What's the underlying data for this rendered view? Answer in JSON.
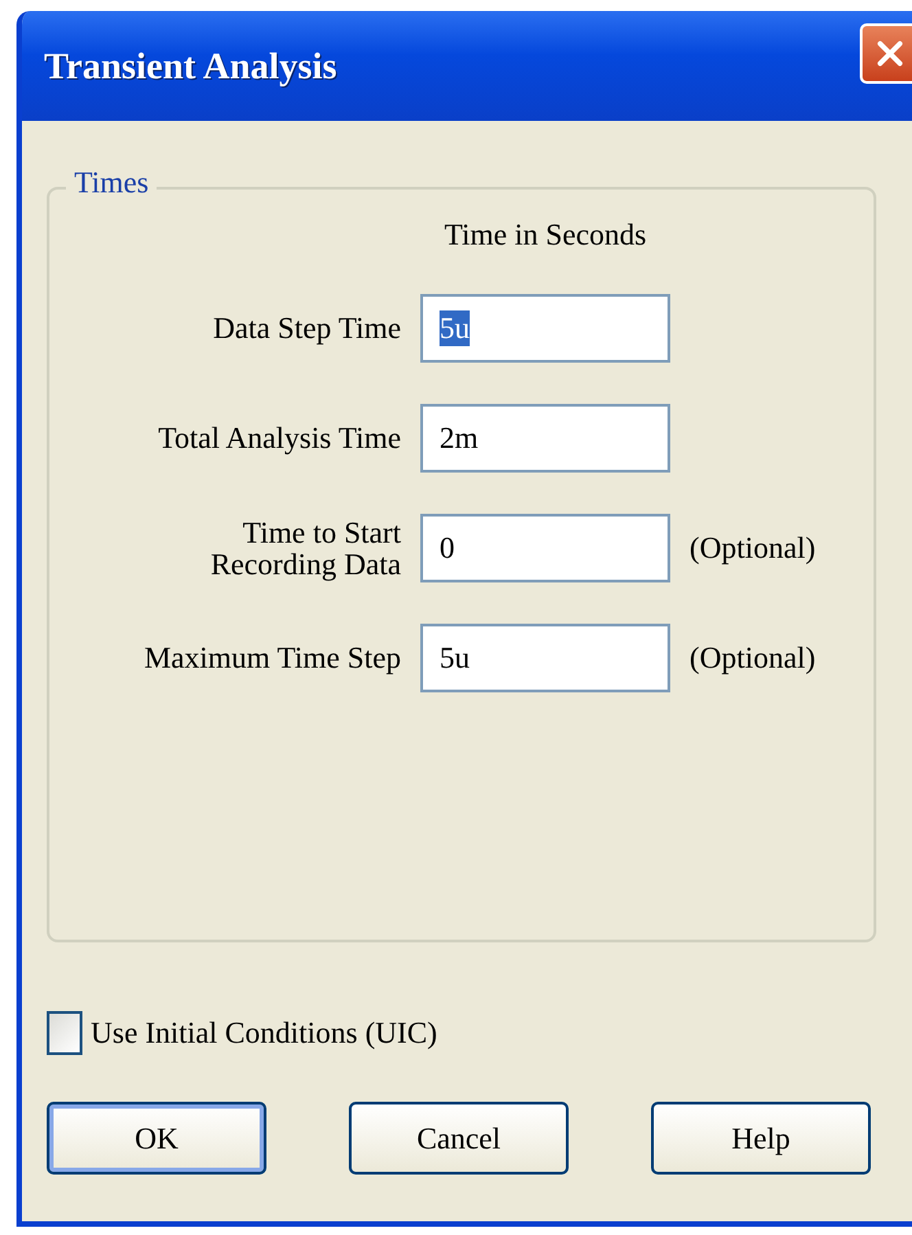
{
  "window": {
    "title": "Transient Analysis"
  },
  "group": {
    "title": "Times",
    "column_heading": "Time in Seconds",
    "fields": [
      {
        "label": "Data Step Time",
        "value": "5u",
        "text_selected": true
      },
      {
        "label": "Total Analysis Time",
        "value": "2m",
        "text_selected": false
      },
      {
        "label": "Time to Start\nRecording Data",
        "value": "0",
        "text_selected": false,
        "note": "(Optional)"
      },
      {
        "label": "Maximum Time Step",
        "value": "5u",
        "text_selected": false,
        "note": "(Optional)"
      }
    ]
  },
  "checkbox": {
    "label": "Use Initial Conditions (UIC)",
    "checked": false
  },
  "buttons": [
    {
      "label": "OK",
      "default": true
    },
    {
      "label": "Cancel",
      "default": false
    },
    {
      "label": "Help",
      "default": false
    }
  ]
}
